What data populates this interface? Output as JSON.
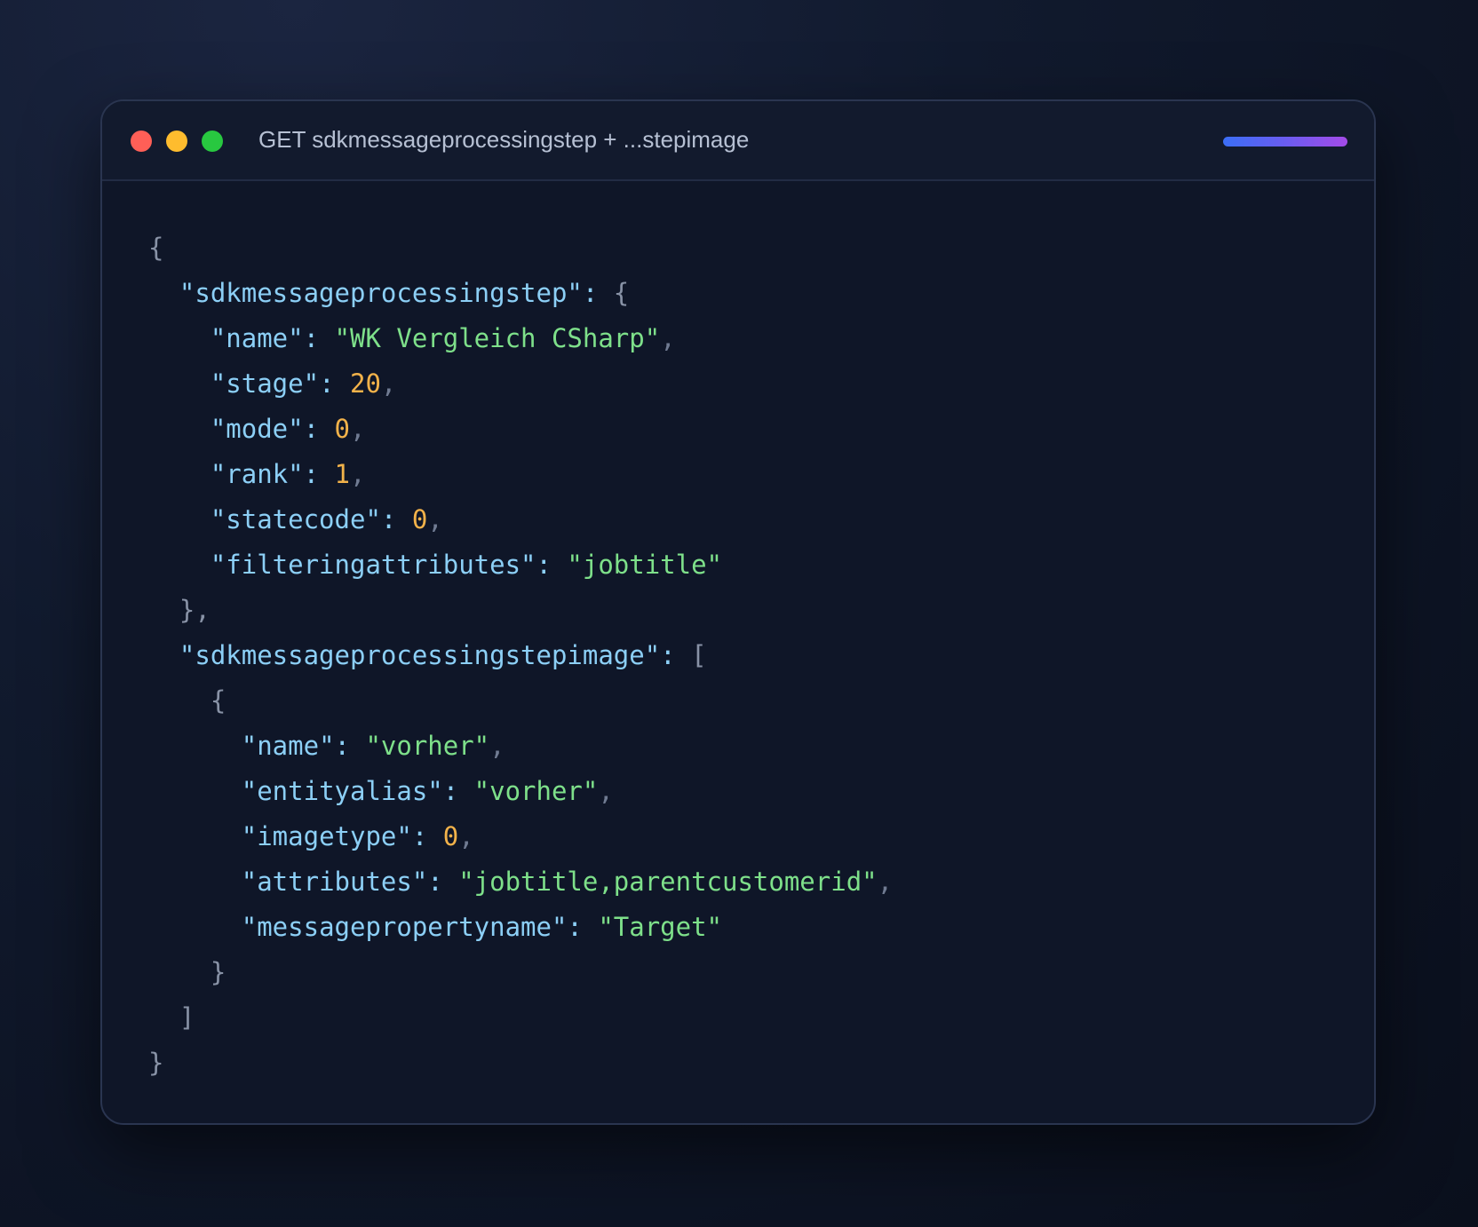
{
  "window": {
    "title": "GET sdkmessageprocessingstep + ...stepimage",
    "accent_gradient": [
      "#3b6ef6",
      "#a44be8"
    ],
    "traffic_lights": {
      "close": "#ff5f57",
      "minimize": "#febc2e",
      "maximize": "#28c840"
    }
  },
  "code": {
    "open_root": "{",
    "close_root": "}",
    "step": {
      "key": "\"sdkmessageprocessingstep\"",
      "open": "{",
      "close": "},",
      "fields": [
        {
          "key": "\"name\"",
          "value": "\"WK Vergleich CSharp\"",
          "type": "string",
          "comma": ","
        },
        {
          "key": "\"stage\"",
          "value": "20",
          "type": "number",
          "comma": ","
        },
        {
          "key": "\"mode\"",
          "value": "0",
          "type": "number",
          "comma": ","
        },
        {
          "key": "\"rank\"",
          "value": "1",
          "type": "number",
          "comma": ","
        },
        {
          "key": "\"statecode\"",
          "value": "0",
          "type": "number",
          "comma": ","
        },
        {
          "key": "\"filteringattributes\"",
          "value": "\"jobtitle\"",
          "type": "string",
          "comma": ""
        }
      ]
    },
    "image": {
      "key": "\"sdkmessageprocessingstepimage\"",
      "open": "[",
      "close": "]",
      "item_open": "{",
      "item_close": "}",
      "fields": [
        {
          "key": "\"name\"",
          "value": "\"vorher\"",
          "type": "string",
          "comma": ","
        },
        {
          "key": "\"entityalias\"",
          "value": "\"vorher\"",
          "type": "string",
          "comma": ","
        },
        {
          "key": "\"imagetype\"",
          "value": "0",
          "type": "number",
          "comma": ","
        },
        {
          "key": "\"attributes\"",
          "value": "\"jobtitle,parentcustomerid\"",
          "type": "string",
          "comma": ","
        },
        {
          "key": "\"messagepropertyname\"",
          "value": "\"Target\"",
          "type": "string",
          "comma": ""
        }
      ]
    }
  }
}
